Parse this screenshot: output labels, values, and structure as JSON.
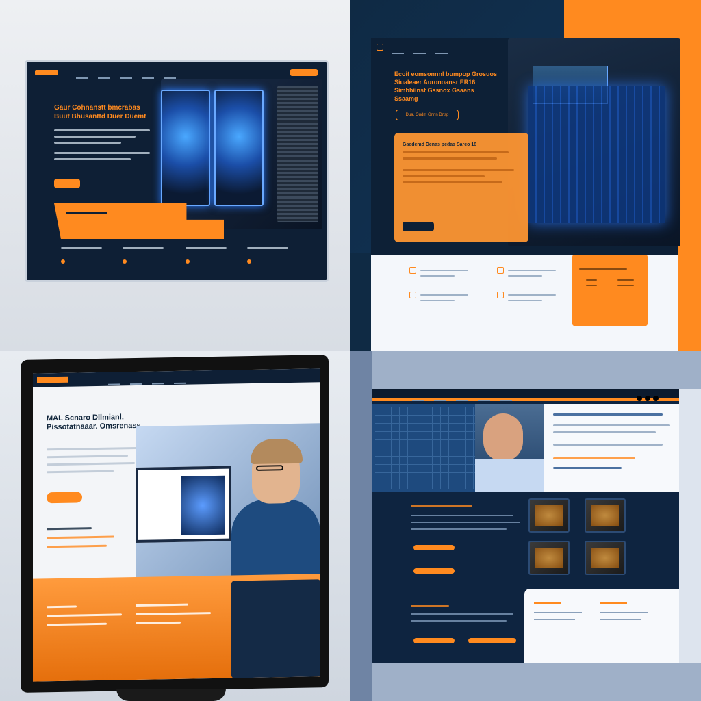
{
  "panel_a": {
    "headline": "Gaur Cohnanstt bmcrabas Buut Bhusanttd Duer Duemt"
  },
  "panel_b": {
    "headline": "Ecoit eomsonnnl bumpop Grosuos Siualeaer Auronoansr ER16 Simbhiinst Gssnox Gsaans Ssaamg",
    "cta_label": "Dua. Oudm Gnnn Dnsp",
    "card_title": "Gaedemd Denas pedas Sareo 18"
  },
  "panel_c": {
    "headline": "MAL Scnaro Dllmianl. Pissotatnaaar. Omsrenass"
  },
  "panel_d": {}
}
